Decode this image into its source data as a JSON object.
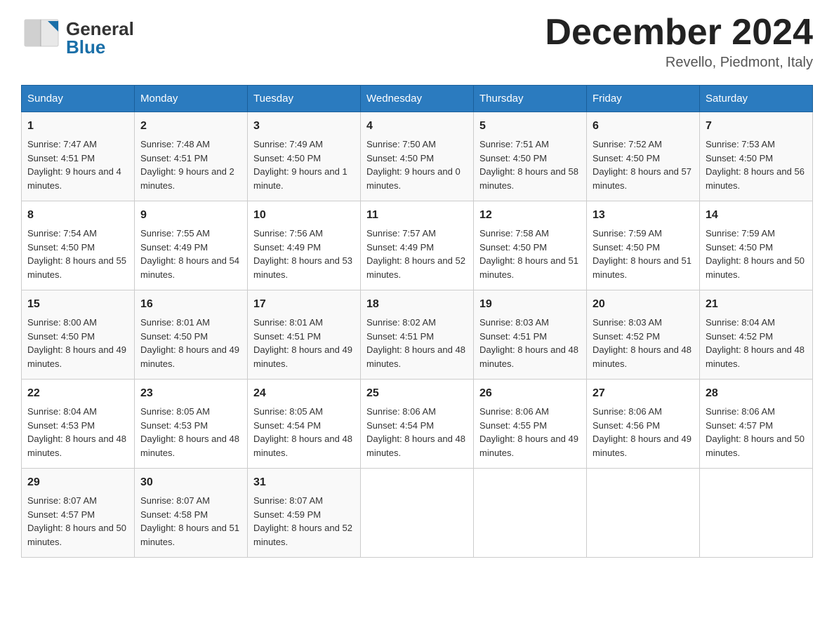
{
  "header": {
    "logo_general": "General",
    "logo_blue": "Blue",
    "month_title": "December 2024",
    "location": "Revello, Piedmont, Italy"
  },
  "days_of_week": [
    "Sunday",
    "Monday",
    "Tuesday",
    "Wednesday",
    "Thursday",
    "Friday",
    "Saturday"
  ],
  "weeks": [
    [
      {
        "num": "1",
        "sunrise": "7:47 AM",
        "sunset": "4:51 PM",
        "daylight": "9 hours and 4 minutes."
      },
      {
        "num": "2",
        "sunrise": "7:48 AM",
        "sunset": "4:51 PM",
        "daylight": "9 hours and 2 minutes."
      },
      {
        "num": "3",
        "sunrise": "7:49 AM",
        "sunset": "4:50 PM",
        "daylight": "9 hours and 1 minute."
      },
      {
        "num": "4",
        "sunrise": "7:50 AM",
        "sunset": "4:50 PM",
        "daylight": "9 hours and 0 minutes."
      },
      {
        "num": "5",
        "sunrise": "7:51 AM",
        "sunset": "4:50 PM",
        "daylight": "8 hours and 58 minutes."
      },
      {
        "num": "6",
        "sunrise": "7:52 AM",
        "sunset": "4:50 PM",
        "daylight": "8 hours and 57 minutes."
      },
      {
        "num": "7",
        "sunrise": "7:53 AM",
        "sunset": "4:50 PM",
        "daylight": "8 hours and 56 minutes."
      }
    ],
    [
      {
        "num": "8",
        "sunrise": "7:54 AM",
        "sunset": "4:50 PM",
        "daylight": "8 hours and 55 minutes."
      },
      {
        "num": "9",
        "sunrise": "7:55 AM",
        "sunset": "4:49 PM",
        "daylight": "8 hours and 54 minutes."
      },
      {
        "num": "10",
        "sunrise": "7:56 AM",
        "sunset": "4:49 PM",
        "daylight": "8 hours and 53 minutes."
      },
      {
        "num": "11",
        "sunrise": "7:57 AM",
        "sunset": "4:49 PM",
        "daylight": "8 hours and 52 minutes."
      },
      {
        "num": "12",
        "sunrise": "7:58 AM",
        "sunset": "4:50 PM",
        "daylight": "8 hours and 51 minutes."
      },
      {
        "num": "13",
        "sunrise": "7:59 AM",
        "sunset": "4:50 PM",
        "daylight": "8 hours and 51 minutes."
      },
      {
        "num": "14",
        "sunrise": "7:59 AM",
        "sunset": "4:50 PM",
        "daylight": "8 hours and 50 minutes."
      }
    ],
    [
      {
        "num": "15",
        "sunrise": "8:00 AM",
        "sunset": "4:50 PM",
        "daylight": "8 hours and 49 minutes."
      },
      {
        "num": "16",
        "sunrise": "8:01 AM",
        "sunset": "4:50 PM",
        "daylight": "8 hours and 49 minutes."
      },
      {
        "num": "17",
        "sunrise": "8:01 AM",
        "sunset": "4:51 PM",
        "daylight": "8 hours and 49 minutes."
      },
      {
        "num": "18",
        "sunrise": "8:02 AM",
        "sunset": "4:51 PM",
        "daylight": "8 hours and 48 minutes."
      },
      {
        "num": "19",
        "sunrise": "8:03 AM",
        "sunset": "4:51 PM",
        "daylight": "8 hours and 48 minutes."
      },
      {
        "num": "20",
        "sunrise": "8:03 AM",
        "sunset": "4:52 PM",
        "daylight": "8 hours and 48 minutes."
      },
      {
        "num": "21",
        "sunrise": "8:04 AM",
        "sunset": "4:52 PM",
        "daylight": "8 hours and 48 minutes."
      }
    ],
    [
      {
        "num": "22",
        "sunrise": "8:04 AM",
        "sunset": "4:53 PM",
        "daylight": "8 hours and 48 minutes."
      },
      {
        "num": "23",
        "sunrise": "8:05 AM",
        "sunset": "4:53 PM",
        "daylight": "8 hours and 48 minutes."
      },
      {
        "num": "24",
        "sunrise": "8:05 AM",
        "sunset": "4:54 PM",
        "daylight": "8 hours and 48 minutes."
      },
      {
        "num": "25",
        "sunrise": "8:06 AM",
        "sunset": "4:54 PM",
        "daylight": "8 hours and 48 minutes."
      },
      {
        "num": "26",
        "sunrise": "8:06 AM",
        "sunset": "4:55 PM",
        "daylight": "8 hours and 49 minutes."
      },
      {
        "num": "27",
        "sunrise": "8:06 AM",
        "sunset": "4:56 PM",
        "daylight": "8 hours and 49 minutes."
      },
      {
        "num": "28",
        "sunrise": "8:06 AM",
        "sunset": "4:57 PM",
        "daylight": "8 hours and 50 minutes."
      }
    ],
    [
      {
        "num": "29",
        "sunrise": "8:07 AM",
        "sunset": "4:57 PM",
        "daylight": "8 hours and 50 minutes."
      },
      {
        "num": "30",
        "sunrise": "8:07 AM",
        "sunset": "4:58 PM",
        "daylight": "8 hours and 51 minutes."
      },
      {
        "num": "31",
        "sunrise": "8:07 AM",
        "sunset": "4:59 PM",
        "daylight": "8 hours and 52 minutes."
      },
      null,
      null,
      null,
      null
    ]
  ],
  "labels": {
    "sunrise": "Sunrise:",
    "sunset": "Sunset:",
    "daylight": "Daylight:"
  }
}
